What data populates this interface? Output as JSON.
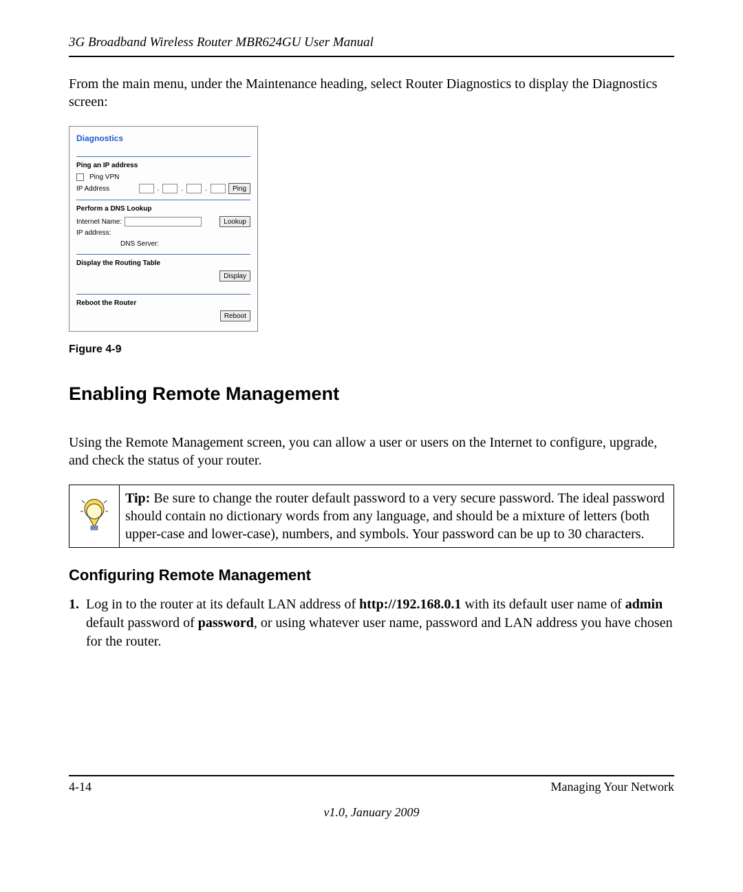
{
  "doc": {
    "title": "3G Broadband Wireless Router MBR624GU User Manual",
    "intro": "From the main menu, under the Maintenance heading, select Router Diagnostics to display the Diagnostics screen:",
    "figure_label": "Figure 4-9",
    "h2": "Enabling Remote Management",
    "remote_intro": "Using the Remote Management screen, you can allow a user or users on the Internet to configure, upgrade, and check the status of your router.",
    "tip_label": "Tip:",
    "tip_body": " Be sure to change the router default password to a very secure password. The ideal password should contain no dictionary words from any language, and should be a mixture of letters (both upper-case and lower-case), numbers, and symbols. Your password can be up to 30 characters.",
    "h3": "Configuring Remote Management",
    "step1_num": "1.",
    "step1_a": "Log in to the router at its default LAN address of ",
    "step1_url": "http://192.168.0.1",
    "step1_b": " with its default user name of ",
    "step1_admin": "admin",
    "step1_c": " default password of ",
    "step1_pw": "password",
    "step1_d": ", or using whatever user name, password and LAN address you have chosen for the router.",
    "footer_left": "4-14",
    "footer_right": "Managing Your Network",
    "footer_center": "v1.0, January 2009"
  },
  "panel": {
    "title": "Diagnostics",
    "ping_heading": "Ping an IP address",
    "ping_vpn_label": "Ping VPN",
    "ip_address_label": "IP Address",
    "ping_btn": "Ping",
    "dns_heading": "Perform a DNS Lookup",
    "internet_name_label": "Internet Name:",
    "lookup_btn": "Lookup",
    "ip_address2_label": "IP address:",
    "dns_server_label": "DNS Server:",
    "routing_heading": "Display the Routing Table",
    "display_btn": "Display",
    "reboot_heading": "Reboot the Router",
    "reboot_btn": "Reboot"
  }
}
